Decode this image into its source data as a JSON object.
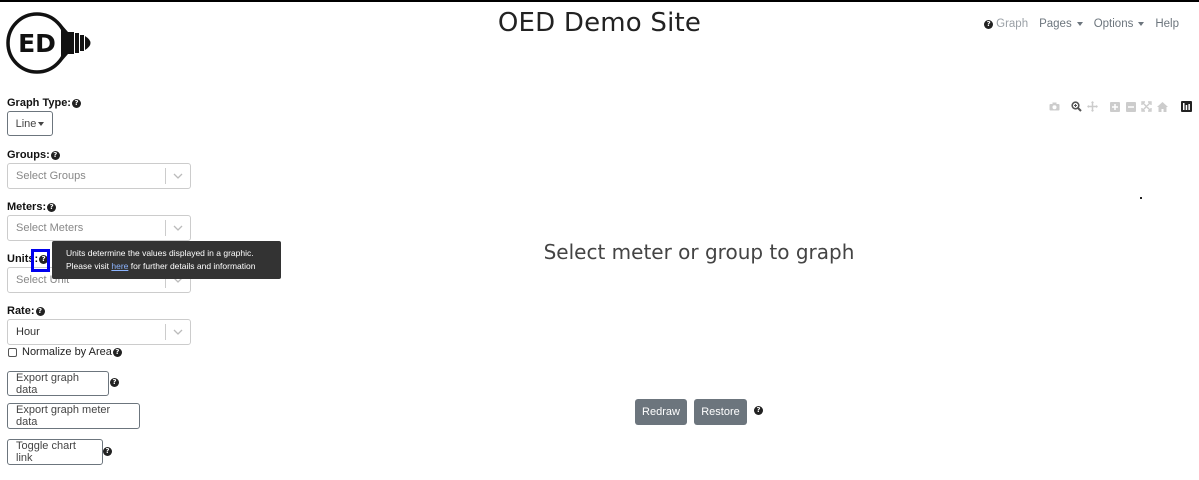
{
  "header": {
    "title": "OED Demo Site",
    "logo_text": "ED"
  },
  "nav": {
    "graph": "Graph",
    "pages": "Pages",
    "options": "Options",
    "help": "Help"
  },
  "sidebar": {
    "graph_type_label": "Graph Type:",
    "graph_type_value": "Line",
    "groups_label": "Groups:",
    "groups_placeholder": "Select Groups",
    "meters_label": "Meters:",
    "meters_placeholder": "Select Meters",
    "units_label": "Units:",
    "units_placeholder": "Select Unit",
    "rate_label": "Rate:",
    "rate_value": "Hour",
    "normalize_label": "Normalize by Area",
    "export_graph_data": "Export graph data",
    "export_meter_data": "Export graph meter data",
    "toggle_chart_link": "Toggle chart link"
  },
  "tooltip": {
    "line1": "Units determine the values displayed in a graphic.",
    "line2_pre": "Please visit ",
    "link": "here",
    "line2_post": " for further details and information"
  },
  "plot": {
    "message": "Select meter or group to graph",
    "redraw": "Redraw",
    "restore": "Restore"
  },
  "modebar_icons": [
    "camera-icon",
    "zoom-icon",
    "pan-icon",
    "zoom-in-icon",
    "zoom-out-icon",
    "autoscale-icon",
    "reset-axes-icon",
    "plotly-logo-icon"
  ]
}
